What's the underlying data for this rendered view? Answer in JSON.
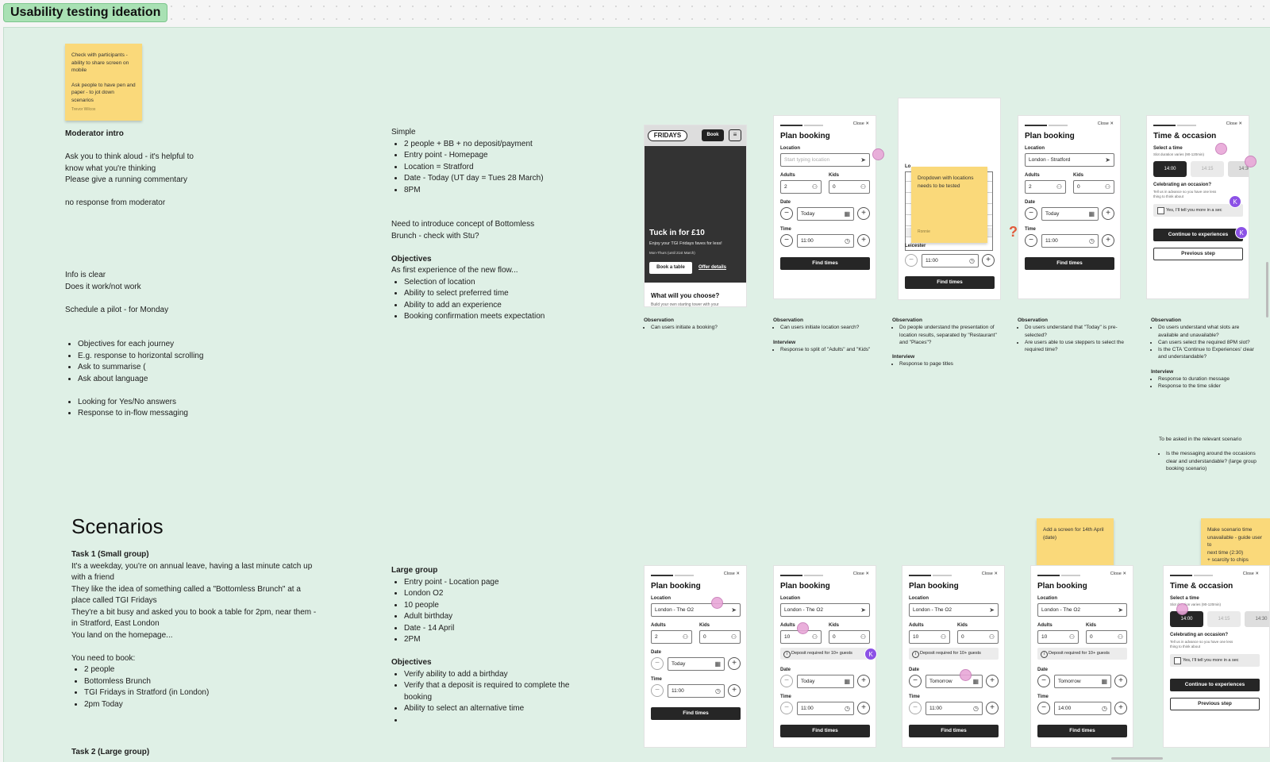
{
  "board": {
    "title": "Usability testing ideation",
    "colors": {
      "section_bg": "#dff0e6",
      "sticky": "#fad97a",
      "title_tag": "#a9e1b4",
      "cursor": "#e8a7d8",
      "avatar": "#8c52e6"
    }
  },
  "stickies": {
    "top_left": {
      "text1": "Check with participants - ability to share screen on mobile",
      "text2": "Ask people to have pen and paper - to jot down scenarios",
      "author": "Trevor Wilcox"
    },
    "dropdown": {
      "text": "Dropdown with locations needs to be tested",
      "author": "Ronnie"
    },
    "add_screen": {
      "text": "Add a screen for 14th April (date)"
    },
    "make_unavailable": {
      "text1": "Make scenario time unavailable - guide user to",
      "text2": "next time (2:30)",
      "text3": "+ scarcity to chips"
    }
  },
  "left_notes": {
    "heading": "Moderator intro",
    "lines": [
      "Ask you to think aloud - it's helpful to",
      "know what you're thinking",
      "Please give a running commentary"
    ],
    "no_response": "no response from moderator",
    "info1": "Info is clear",
    "info2": "Does it work/not work",
    "pilot": "Schedule a pilot - for Monday",
    "bullets1": [
      "Objectives for each journey",
      "E.g. response to horizontal scrolling",
      "Ask to summarise (",
      "Ask about language"
    ],
    "bullets2": [
      "Looking for Yes/No answers",
      "Response to in-flow messaging"
    ]
  },
  "simple": {
    "heading": "Simple",
    "bullets": [
      "2 people + BB + no deposit/payment",
      "Entry point - Homepage",
      "Location = Stratford",
      "Date - Today (UT day = Tues 28 March)",
      "8PM"
    ],
    "intro1": "Need to introduce concept of Bottomless",
    "intro2": "Brunch - check with Stu?",
    "objectives_heading": "Objectives",
    "objectives_intro": "As first experience of the new flow...",
    "objectives": [
      "Selection of location",
      "Ability to select preferred time",
      "Ability to add an experience",
      "Booking confirmation meets expectation"
    ]
  },
  "scenarios": {
    "title": "Scenarios",
    "task1_heading": "Task 1 (Small group)",
    "task1_lines": [
      "It's a weekday, you're on annual leave, having a last minute catch up",
      "with a friend",
      "They like the idea of something called a \"Bottomless Brunch\" at a",
      "place called TGI Fridays",
      "They're a bit busy and asked you to book a table for 2pm, near them -",
      "in Stratford, East London",
      "You land on the homepage..."
    ],
    "need_to_book": "You need to book:",
    "book_items": [
      "2 people",
      "Bottomless Brunch",
      "TGI Fridays in Stratford (in London)",
      "2pm Today"
    ],
    "task2_heading": "Task 2 (Large group)"
  },
  "large_group": {
    "heading": "Large group",
    "bullets": [
      "Entry point - Location page",
      "London O2",
      "10 people",
      "Adult birthday",
      "Date - 14 April",
      "2PM"
    ],
    "objectives_heading": "Objectives",
    "objectives": [
      "Verify ability to add a birthday",
      "Verify that a deposit is required to complete the booking",
      "Ability to select an alternative time",
      ""
    ]
  },
  "phone_common": {
    "close": "Close ✕",
    "plan_booking": "Plan booking",
    "location": "Location",
    "adults": "Adults",
    "kids": "Kids",
    "date": "Date",
    "time": "Time",
    "find_times": "Find times",
    "location_placeholder": "Start typing location",
    "time_occasion": "Time & occasion",
    "select_time": "Select a time",
    "slot_duration": "Slot duration varies (90-120min)",
    "celebrating": "Celebrating an occasion?",
    "celebrating_sub": "Tell us in advance so you have one less thing to think about",
    "yes_tell": "Yes, I'll tell you more in a sec",
    "continue": "Continue to experiences",
    "previous": "Previous step",
    "deposit": "Deposit required for 10+ guests",
    "today": "Today",
    "tomorrow": "Tomorrow",
    "t1100": "11:00",
    "t1400": "14:00",
    "s1400": "14:00",
    "s1415": "14:15",
    "s1430": "14:30",
    "stratford": "London - Stratford",
    "o2": "London - The O2",
    "leicester": "Leicester",
    "lo": "Lo",
    "zero": "0",
    "two": "2",
    "ten": "10"
  },
  "fridays": {
    "logo": "FRIDAYS",
    "book": "Book",
    "hero_title": "Tuck in for £10",
    "hero_sub": "Enjoy your TGI Fridays faves for less!",
    "hero_sub2": "Mon-Thurs (until 21st March)",
    "book_table": "Book a table",
    "offer_details": "Offer details",
    "what_choose": "What will you choose?",
    "what_sub": "Build your own starting tower with your"
  },
  "observations": {
    "obs_label": "Observation",
    "int_label": "Interview",
    "col1": [
      "Can users initiate a booking?"
    ],
    "col2_obs": [
      "Can users initiate location search?"
    ],
    "col2_int": [
      "Response to split of \"Adults\" and \"Kids\""
    ],
    "col3_obs": [
      "Do people understand the presentation of location results, separated by \"Restaurant\" and \"Places\"?"
    ],
    "col3_int": [
      "Response to page titles"
    ],
    "col4_obs": [
      "Do users understand that \"Today\" is pre-selected?",
      "Are users able to use steppers to select the required time?"
    ],
    "col5_obs": [
      "Do users understand what slots are available and unavailable?",
      "Can users select the required 8PM slot?",
      "Is the CTA 'Continue to Experiences' clear and understandable?"
    ],
    "col5_int": [
      "Response to duration message",
      "Response to the time slider"
    ],
    "relevant": "To be asked in the relevant scenario",
    "relevant_bullet": "Is the messaging around the occasions clear and understandable? (large group booking scenario)"
  },
  "avatar_initial": "K"
}
